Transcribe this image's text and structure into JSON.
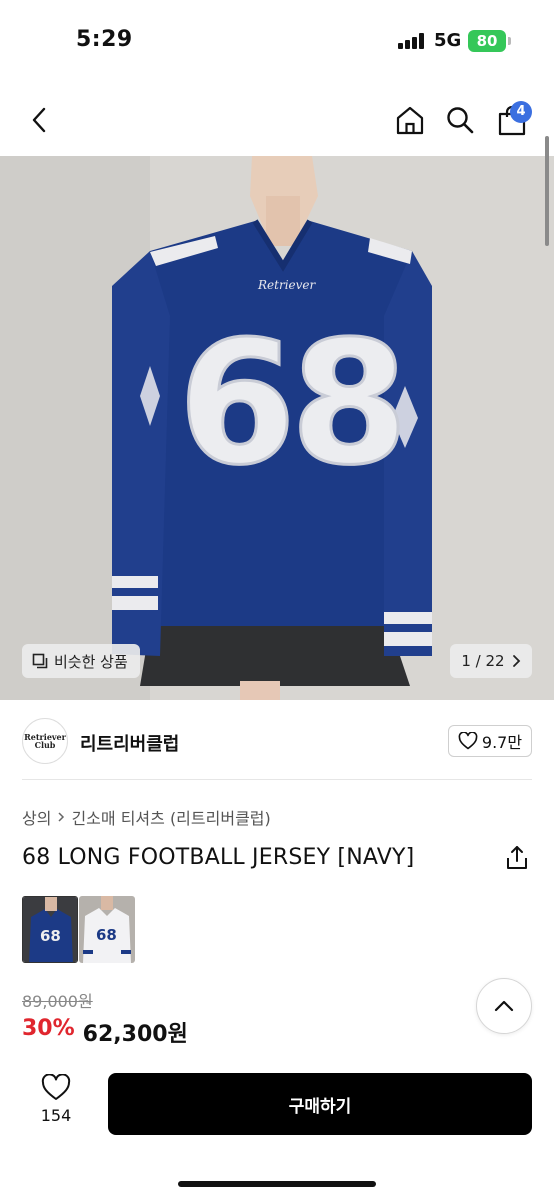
{
  "status_bar": {
    "time": "5:29",
    "network": "5G",
    "battery": "80"
  },
  "nav": {
    "back_icon": "chevron-left-icon",
    "home_icon": "home-icon",
    "search_icon": "search-icon",
    "bag_icon": "shopping-bag-icon",
    "cart_count": "4"
  },
  "hero": {
    "similar_label": "비슷한 상품",
    "pager": "1 / 22",
    "jersey_number": "68",
    "chest_script": "Retriever"
  },
  "brand": {
    "logo_line1": "Retriever",
    "logo_line2": "Club",
    "name": "리트리버클럽",
    "likes": "9.7만"
  },
  "product": {
    "breadcrumb": [
      "상의",
      "긴소매 티셔츠 (리트리버클럽)"
    ],
    "title": "68 LONG FOOTBALL JERSEY [NAVY]",
    "thumbnails": [
      {
        "color": "navy",
        "number": "68"
      },
      {
        "color": "white",
        "number": "68"
      }
    ],
    "original_price": "89,000원",
    "discount": "30%",
    "sale_price": "62,300원"
  },
  "bottom_bar": {
    "wish_count": "154",
    "buy_label": "구매하기"
  },
  "colors": {
    "accent_blue": "#3b6fe0",
    "discount_red": "#e0262e",
    "battery_green": "#35c759",
    "jersey_navy": "#1c3a86"
  }
}
